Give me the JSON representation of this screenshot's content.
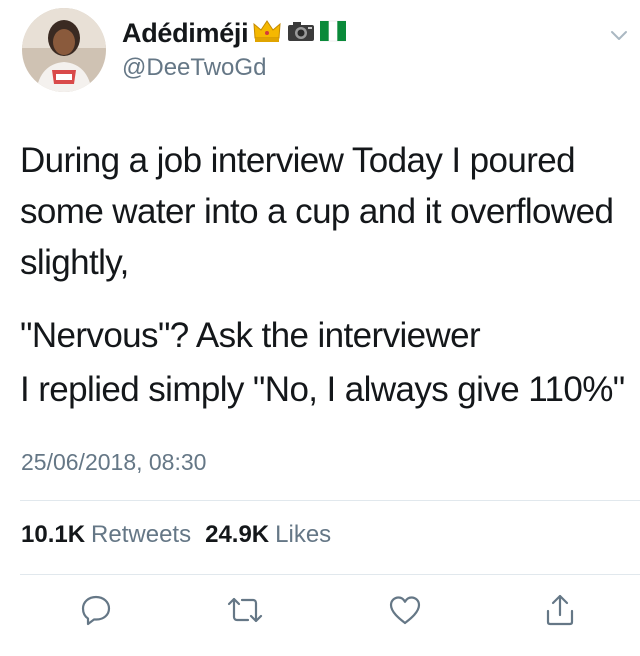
{
  "user": {
    "display_name": "Adédiméji",
    "handle": "@DeeTwoGd",
    "emoji_icons": [
      "crown-icon",
      "camera-icon",
      "nigeria-flag-icon"
    ]
  },
  "tweet": {
    "paragraphs": [
      "During a job interview Today I poured some water into a cup and it overflowed slightly,",
      "\"Nervous\"? Ask the interviewer",
      "I replied simply \"No, I always give 110%\""
    ],
    "timestamp": "25/06/2018, 08:30"
  },
  "stats": {
    "retweets_count": "10.1K",
    "retweets_label": "Retweets",
    "likes_count": "24.9K",
    "likes_label": "Likes"
  },
  "actions": [
    "reply-icon",
    "retweet-icon",
    "like-icon",
    "share-icon"
  ],
  "colors": {
    "text": "#14171a",
    "secondary": "#657786",
    "divider": "#e1e8ed",
    "icon": "#657786"
  }
}
